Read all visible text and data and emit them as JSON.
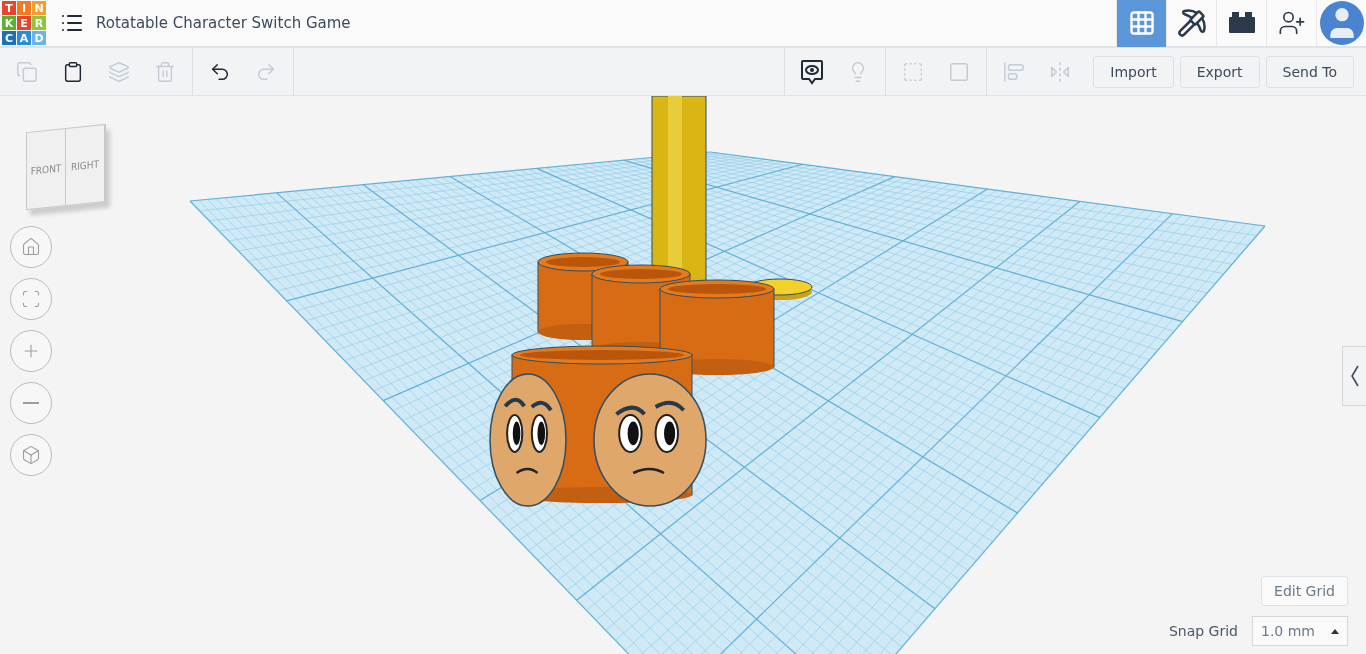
{
  "logo": {
    "letters": [
      {
        "char": "T",
        "color": "#e8452c"
      },
      {
        "char": "I",
        "color": "#f27a21"
      },
      {
        "char": "N",
        "color": "#f59c2a"
      },
      {
        "char": "K",
        "color": "#5cb030"
      },
      {
        "char": "E",
        "color": "#e8452c"
      },
      {
        "char": "R",
        "color": "#8cc63f"
      },
      {
        "char": "C",
        "color": "#1d70b8"
      },
      {
        "char": "A",
        "color": "#2a8ed6"
      },
      {
        "char": "D",
        "color": "#6bb5e6"
      }
    ]
  },
  "title": "Rotatable Character Switch Game",
  "modes": [
    {
      "kind": "grid",
      "selected": true
    },
    {
      "kind": "pickaxe",
      "selected": false
    },
    {
      "kind": "brick",
      "selected": false
    },
    {
      "kind": "add-user",
      "selected": false
    },
    {
      "kind": "avatar",
      "selected": false
    }
  ],
  "edit_tools": [
    {
      "kind": "copy",
      "disabled": true
    },
    {
      "kind": "paste",
      "disabled": false
    },
    {
      "kind": "duplicate",
      "disabled": true
    },
    {
      "kind": "delete",
      "disabled": true
    }
  ],
  "history_tools": [
    {
      "kind": "undo",
      "disabled": false
    },
    {
      "kind": "redo",
      "disabled": true
    }
  ],
  "shape_tools": [
    {
      "kind": "notes",
      "disabled": false
    },
    {
      "kind": "light",
      "disabled": true
    },
    {
      "kind": "group",
      "disabled": true
    },
    {
      "kind": "ungroup",
      "disabled": true
    },
    {
      "kind": "align",
      "disabled": true
    },
    {
      "kind": "mirror",
      "disabled": true
    }
  ],
  "actions": [
    "Import",
    "Export",
    "Send To"
  ],
  "view_cube": {
    "front": "FRONT",
    "right": "RIGHT"
  },
  "nav_buttons": [
    {
      "kind": "home"
    },
    {
      "kind": "fit"
    },
    {
      "kind": "zoom-in"
    },
    {
      "kind": "zoom-out"
    },
    {
      "kind": "perspective"
    }
  ],
  "edit_grid": "Edit Grid",
  "snap_grid": {
    "label": "Snap Grid",
    "value": "1.0 mm"
  }
}
